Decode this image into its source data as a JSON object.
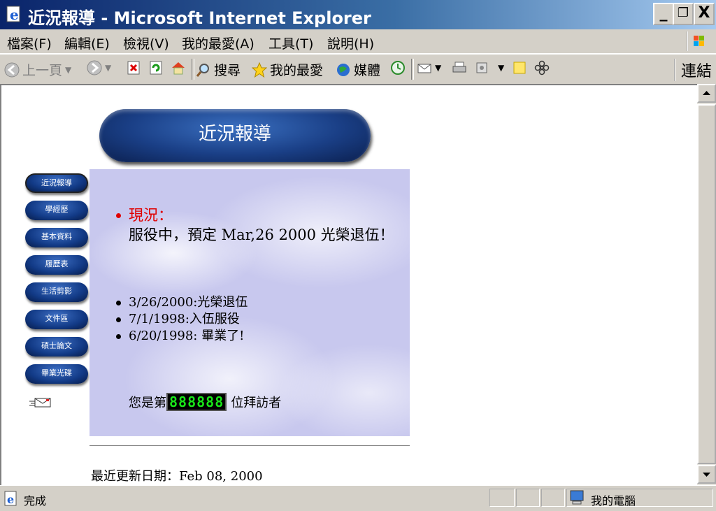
{
  "window": {
    "title": "近況報導 - Microsoft Internet Explorer",
    "controls": {
      "minimize": "_",
      "restore": "❐",
      "close": "X"
    }
  },
  "menu": [
    "檔案(F)",
    "編輯(E)",
    "檢視(V)",
    "我的最愛(A)",
    "工具(T)",
    "說明(H)"
  ],
  "toolbar": {
    "back": "上一頁",
    "search": "搜尋",
    "favorites": "我的最愛",
    "media": "媒體",
    "links": "連結"
  },
  "page": {
    "banner": "近況報導",
    "nav": [
      "近況報導",
      "學經歷",
      "基本資料",
      "履歷表",
      "生活剪影",
      "文件區",
      "碩士論文",
      "畢業光碟"
    ],
    "status_label": "現況：",
    "status_text": "服役中，預定 Mar,26 2000 光榮退伍！",
    "news": [
      "3/26/2000:光榮退伍",
      "7/1/1998:入伍服役",
      "6/20/1998: 畢業了!"
    ],
    "visitor_prefix": "您是第",
    "visitor_count": "888888",
    "visitor_suffix": "位拜訪者",
    "last_updated": "最近更新日期：Feb 08, 2000"
  },
  "statusbar": {
    "status": "完成",
    "zone": "我的電腦"
  },
  "colors": {
    "titlebar_start": "#0a246a",
    "titlebar_end": "#a6caf0",
    "status_label": "#e00000",
    "counter_digits": "#19e619",
    "nav_button": "#123a86"
  }
}
